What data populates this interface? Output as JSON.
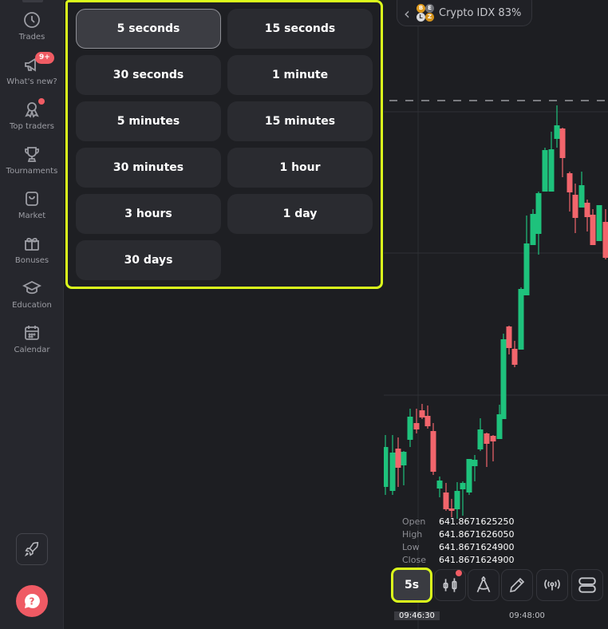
{
  "sidebar": {
    "items": [
      {
        "label": "Trades",
        "icon": "clock-icon"
      },
      {
        "label": "What's new?",
        "icon": "megaphone-icon",
        "badge": "9+"
      },
      {
        "label": "Top traders",
        "icon": "award-icon",
        "dot": true
      },
      {
        "label": "Tournaments",
        "icon": "trophy-icon"
      },
      {
        "label": "Market",
        "icon": "shopping-bag-icon"
      },
      {
        "label": "Bonuses",
        "icon": "gift-icon"
      },
      {
        "label": "Education",
        "icon": "graduation-cap-icon"
      },
      {
        "label": "Calendar",
        "icon": "calendar-icon"
      }
    ],
    "rocket_icon": "rocket-icon",
    "help_icon": "help-chat-icon"
  },
  "period_popup": {
    "selected": "5 seconds",
    "options": [
      "5 seconds",
      "15 seconds",
      "30 seconds",
      "1 minute",
      "5 minutes",
      "15 minutes",
      "30 minutes",
      "1 hour",
      "3 hours",
      "1 day",
      "30 days"
    ]
  },
  "asset": {
    "name": "Crypto IDX 83%",
    "coins": [
      "B",
      "E",
      "L",
      "Z"
    ]
  },
  "ohlc": {
    "open_label": "Open",
    "open": "641.8671625250",
    "high_label": "High",
    "high": "641.8671626050",
    "low_label": "Low",
    "low": "641.8671624900",
    "close_label": "Close",
    "close": "641.8671624900"
  },
  "toolbar": {
    "timeframe": "5s",
    "buttons": [
      "chart-type-icon",
      "compass-drawing-icon",
      "pencil-icon",
      "signals-icon",
      "layout-icon"
    ]
  },
  "time_axis": {
    "current": "09:46:30",
    "labels": [
      "09:48:00"
    ]
  },
  "colors": {
    "accent": "#dcff1c",
    "up": "#1ec27c",
    "down": "#f2656c",
    "badge": "#f05c64"
  }
}
